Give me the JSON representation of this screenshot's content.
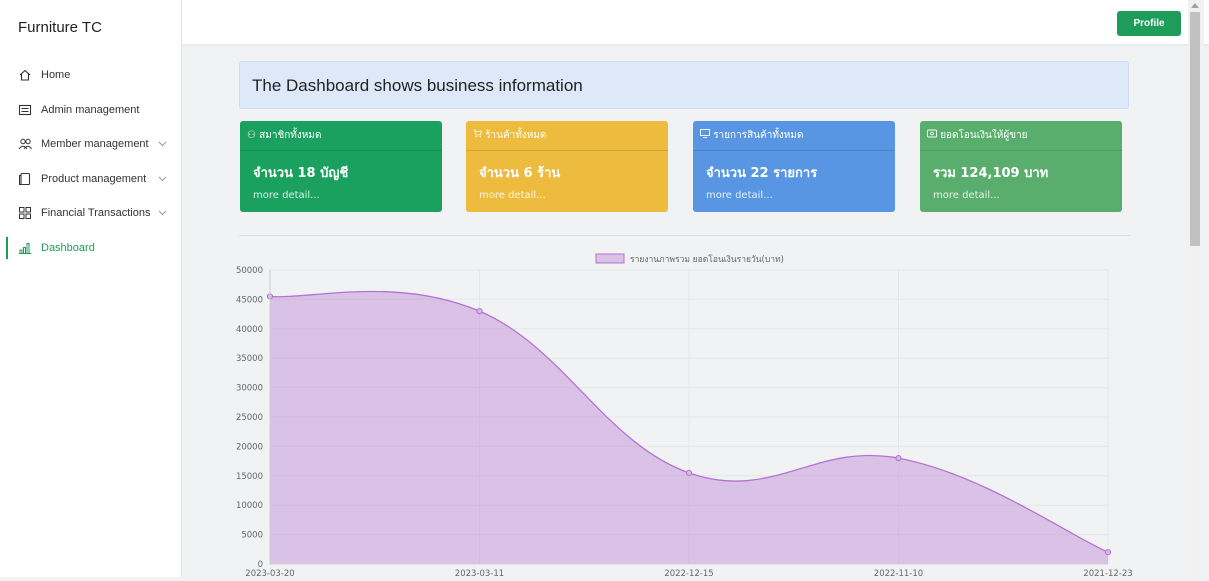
{
  "app": {
    "brand": "Furniture TC"
  },
  "sidebar": {
    "items": [
      {
        "label": "Home",
        "icon": "home-icon"
      },
      {
        "label": "Admin management",
        "icon": "list-icon"
      },
      {
        "label": "Member management",
        "icon": "users-icon",
        "has_submenu": true
      },
      {
        "label": "Product management",
        "icon": "box-icon",
        "has_submenu": true
      },
      {
        "label": "Financial Transactions",
        "icon": "grid-icon",
        "has_submenu": true
      },
      {
        "label": "Dashboard",
        "icon": "bar-chart-icon",
        "active": true
      }
    ]
  },
  "topbar": {
    "profile_label": "Profile"
  },
  "dashboard": {
    "title": "The Dashboard shows business information",
    "cards": [
      {
        "header": "สมาชิกทั้งหมด",
        "icon": "users-icon",
        "value": "จำนวน 18 บัญชี",
        "link": "more detail...",
        "color": "#1aa15f"
      },
      {
        "header": "ร้านค้าทั้งหมด",
        "icon": "cart-icon",
        "value": "จำนวน 6 ร้าน",
        "link": "more detail...",
        "color": "#edbb3e"
      },
      {
        "header": "รายการสินค้าทั้งหมด",
        "icon": "monitor-icon",
        "value": "จำนวน 22 รายการ",
        "link": "more detail...",
        "color": "#5895e2"
      },
      {
        "header": "ยอดโอนเงินให้ผู้ขาย",
        "icon": "wallet-icon",
        "value": "รวม 124,109 บาท",
        "link": "more detail...",
        "color": "#5aae6d"
      }
    ]
  },
  "chart_data": {
    "type": "area",
    "x": [
      "2023-03-20",
      "2023-03-11",
      "2022-12-15",
      "2022-11-10",
      "2021-12-23"
    ],
    "series": [
      {
        "name": "รายงานภาพรวม ยอดโอนเงินรายวัน(บาท)",
        "values": [
          45500,
          43000,
          15500,
          18000,
          2000
        ],
        "color": "#b573d2"
      }
    ],
    "ylim": [
      0,
      50000
    ],
    "yticks": [
      0,
      5000,
      10000,
      15000,
      20000,
      25000,
      30000,
      35000,
      40000,
      45000,
      50000
    ],
    "grid": true,
    "legend": "top-center"
  }
}
